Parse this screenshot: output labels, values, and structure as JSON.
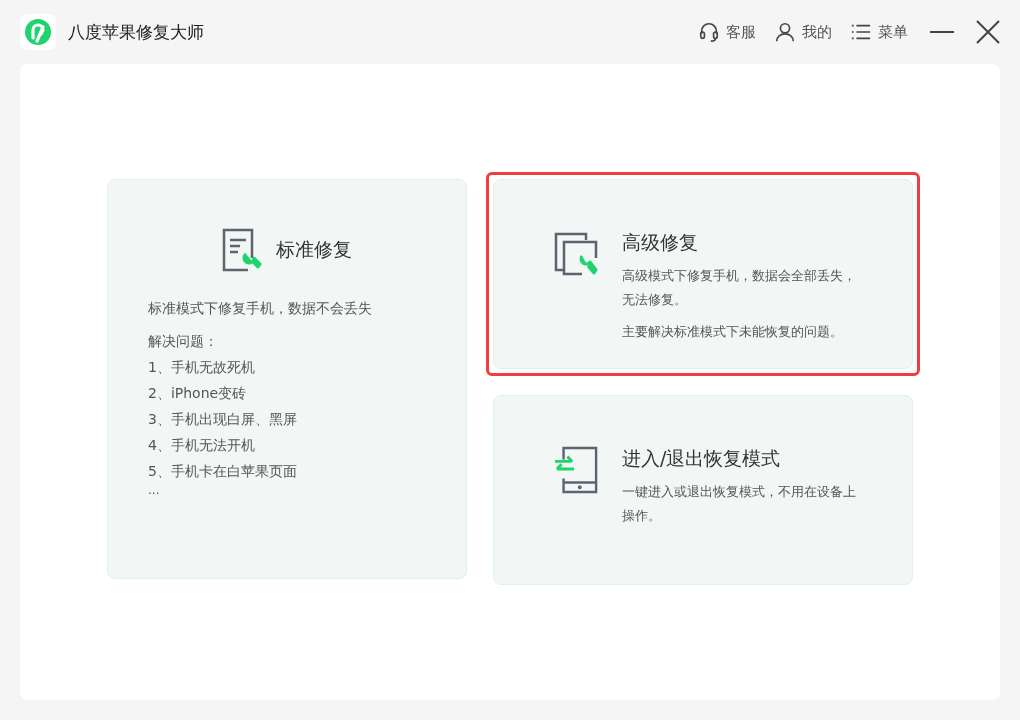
{
  "window": {
    "title": "八度苹果修复大师"
  },
  "header_actions": [
    {
      "kind": "headset",
      "label": "客服"
    },
    {
      "kind": "user",
      "label": "我的"
    },
    {
      "kind": "menu",
      "label": "菜单"
    }
  ],
  "cards": [
    {
      "kind": "standard",
      "title": "标准修复",
      "selected": false,
      "description": [
        "标准模式下修复手机，数据不会丢失"
      ],
      "list_title": "解决问题：",
      "items": [
        "1、手机无故死机",
        "2、iPhone变砖",
        "3、手机出现白屏、黑屏",
        "4、手机无法开机",
        "5、手机卡在白苹果页面"
      ],
      "more": "..."
    },
    {
      "kind": "advanced",
      "title": "高级修复",
      "selected": true,
      "description": [
        "高级模式下修复手机，数据会全部丢失，无法修复。",
        "主要解决标准模式下未能恢复的问题。"
      ]
    },
    {
      "kind": "recovery",
      "title": "进入/退出恢复模式",
      "selected": false,
      "description": [
        "一键进入或退出恢复模式，不用在设备上操作。"
      ]
    }
  ]
}
